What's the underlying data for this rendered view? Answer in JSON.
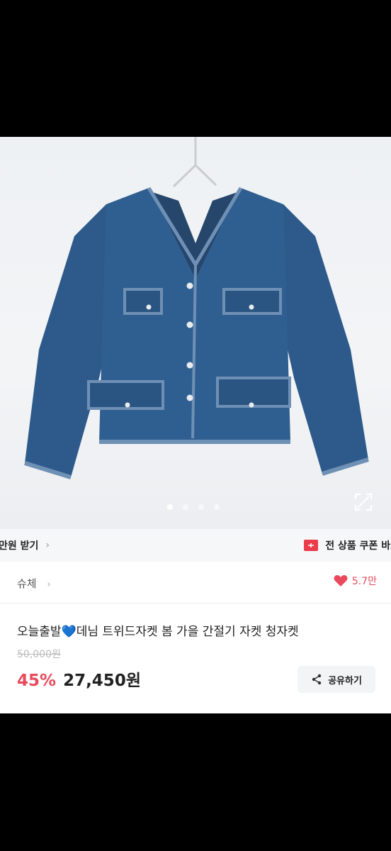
{
  "coupon_bar": {
    "left_label": "만원 받기",
    "left_chevron": "›",
    "right_label": "전 상품 쿠폰 바로",
    "right_icon": "coupon-ticket-icon"
  },
  "gallery": {
    "slide_count": 4,
    "active_index": 0,
    "expand_icon": "expand-icon"
  },
  "seller": {
    "name": "슈체",
    "chevron": "›",
    "likes": "5.7만"
  },
  "product": {
    "title": "오늘출발💙데님 트위드자켓 봄 가을 간절기 자켓 청자켓",
    "original_price": "50,000원",
    "discount": "45%",
    "price": "27,450원"
  },
  "share": {
    "label": "공유하기"
  },
  "colors": {
    "accent": "#e84a5c",
    "coupon_red": "#ea3b4a",
    "denim": "#2d5a8a"
  }
}
